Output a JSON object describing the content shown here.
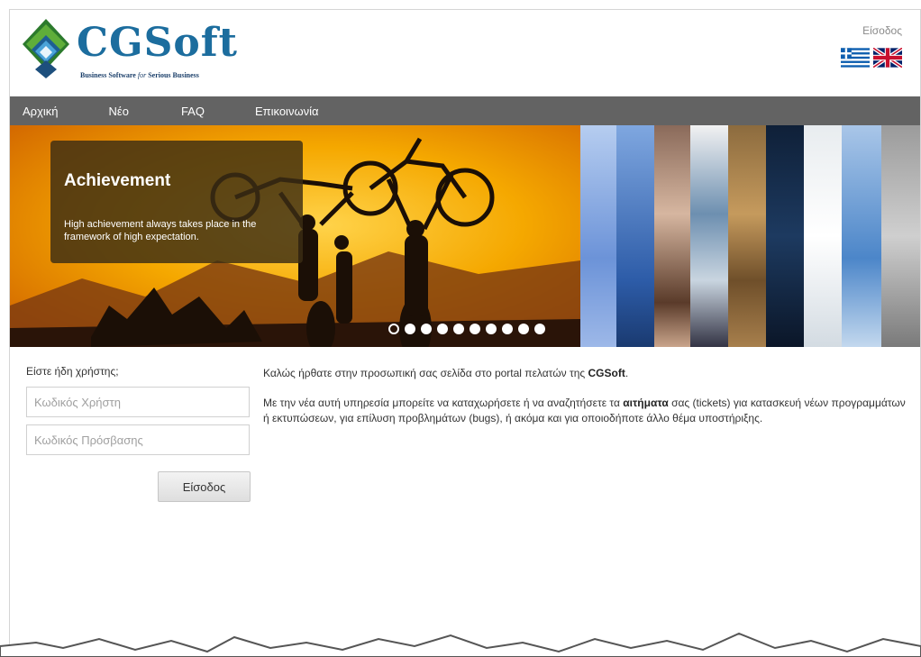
{
  "logo": {
    "brand": "CGSoft",
    "tagline_a": "Business Software",
    "tagline_for": "for",
    "tagline_b": "Serious Business"
  },
  "header": {
    "login_link": "Είσοδος",
    "flags": [
      "greek-flag",
      "uk-flag"
    ]
  },
  "nav": {
    "items": [
      "Αρχική",
      "Νέο",
      "FAQ",
      "Επικοινωνία"
    ]
  },
  "banner": {
    "caption_title": "Achievement",
    "caption_text": "High achievement always takes place in the framework of high expectation.",
    "dot_count": 10,
    "active_dot": 1
  },
  "login": {
    "question": "Είστε ήδη χρήστης;",
    "username_placeholder": "Κωδικός Χρήστη",
    "password_placeholder": "Κωδικός Πρόσβασης",
    "submit": "Είσοδος"
  },
  "welcome": {
    "p1_a": "Καλώς ήρθατε στην προσωπική σας σελίδα στο portal πελατών της ",
    "p1_b": "CGSoft",
    "p1_c": ".",
    "p2_a": "Με την νέα αυτή υπηρεσία μπορείτε να καταχωρήσετε ή να αναζητήσετε τα ",
    "p2_b": "αιτήματα",
    "p2_c": " σας (tickets) για κατασκευή νέων προγραμμάτων ή εκτυπώσεων, για επίλυση προβλημάτων (bugs), ή ακόμα και για οποιοδήποτε άλλο θέμα υποστήριξης."
  },
  "colors": {
    "nav_bg": "#636363",
    "brand_blue": "#1c6d9e",
    "banner_orange": "#f2a600"
  }
}
